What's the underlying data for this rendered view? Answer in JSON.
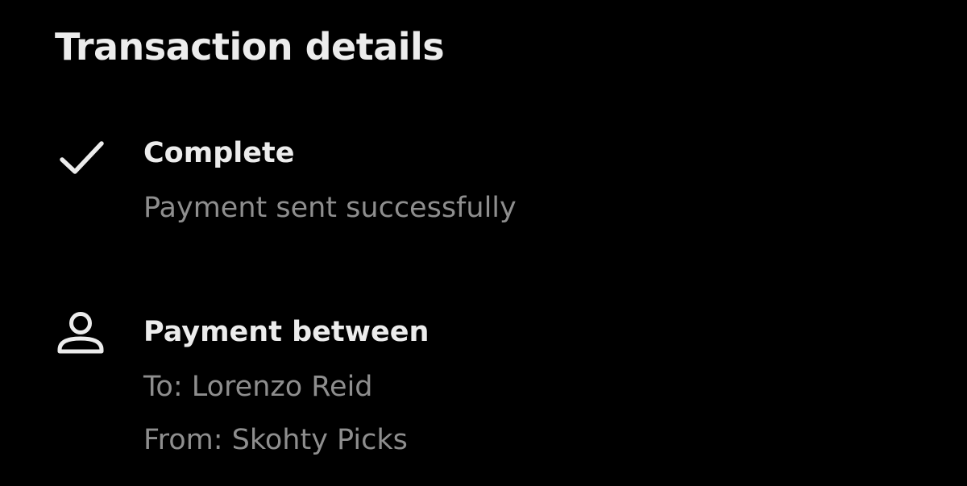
{
  "header": {
    "title": "Transaction details"
  },
  "status": {
    "icon": "checkmark-icon",
    "label": "Complete",
    "detail": "Payment sent successfully"
  },
  "parties": {
    "icon": "person-icon",
    "label": "Payment between",
    "to": "To: Lorenzo Reid",
    "from": "From: Skohty Picks"
  },
  "colors": {
    "background": "#000000",
    "primary_text": "#ececec",
    "secondary_text": "#8e8e8e"
  }
}
